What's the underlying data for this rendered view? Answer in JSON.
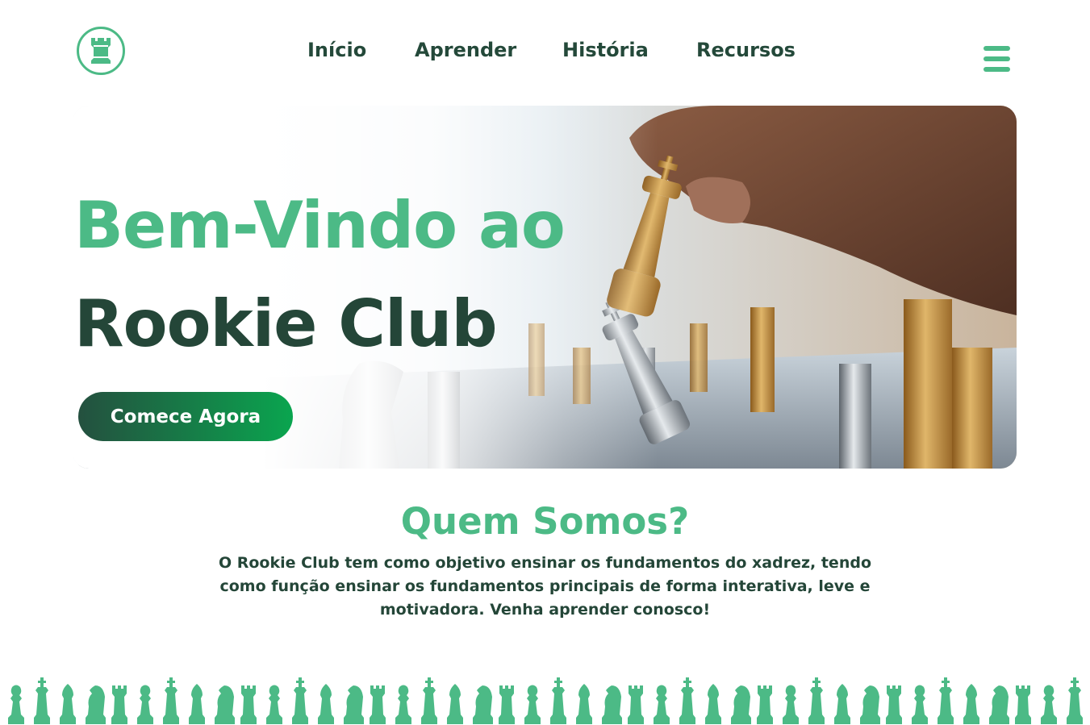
{
  "brand": {
    "logo_icon": "rook-icon",
    "accent": "#4cba86",
    "dark": "#244638"
  },
  "nav": {
    "items": [
      {
        "label": "Início"
      },
      {
        "label": "Aprender"
      },
      {
        "label": "História"
      },
      {
        "label": "Recursos"
      }
    ],
    "menu_icon": "hamburger-menu-icon"
  },
  "hero": {
    "title_line1": "Bem-Vindo ao",
    "title_line2": "Rookie Club",
    "cta_label": "Comece Agora",
    "image_subject": "chess-game-photo"
  },
  "about": {
    "title": "Quem Somos?",
    "text": "O Rookie Club tem como objetivo ensinar os fundamentos do xadrez, tendo como função ensinar os fundamentos principais de forma interativa, leve e motivadora. Venha aprender conosco!"
  },
  "footer": {
    "pattern_icons": [
      "pawn-icon",
      "king-icon",
      "bishop-icon",
      "knight-icon",
      "rook-icon"
    ]
  }
}
